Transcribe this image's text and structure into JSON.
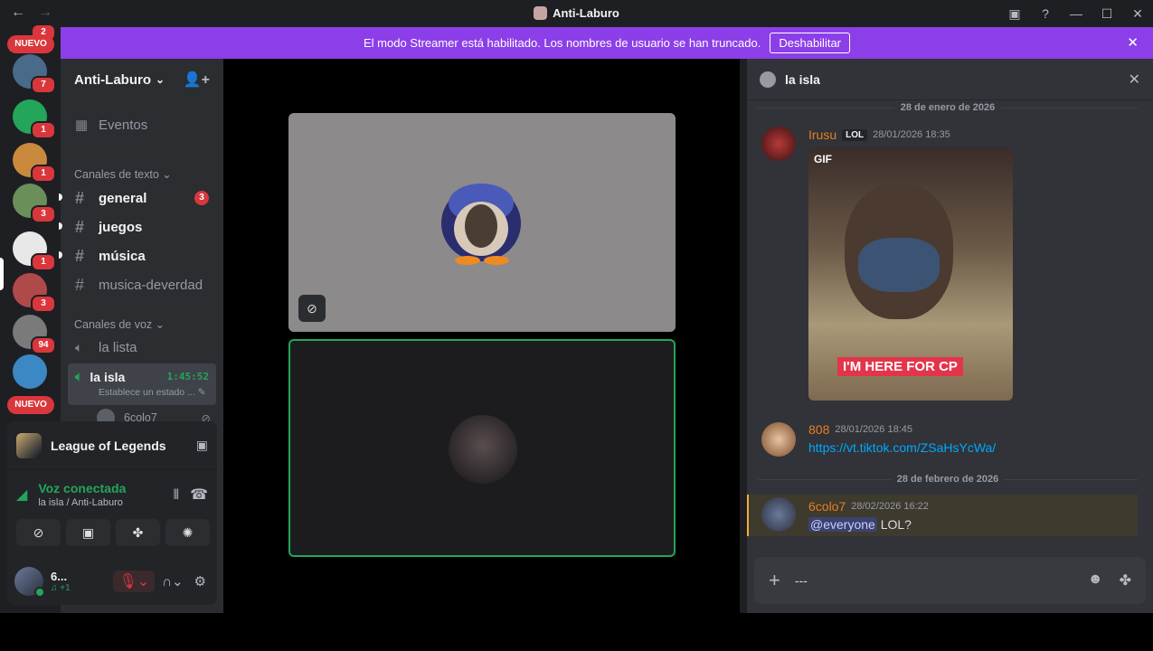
{
  "window": {
    "title": "Anti-Laburo",
    "back_icon": "←",
    "forward_icon": "→",
    "controls": [
      "▣",
      "?",
      "—",
      "☐",
      "✕"
    ]
  },
  "banner": {
    "text": "El modo Streamer está habilitado. Los nombres de usuario se han truncado.",
    "button": "Deshabilitar",
    "close": "✕"
  },
  "rail": {
    "top_badge": "2",
    "nuevo_top": "NUEVO",
    "nuevo_bottom": "NUEVO",
    "servers": [
      {
        "badge": "7",
        "color": "#4a6a8a"
      },
      {
        "badge": "1",
        "color": "#23a55a"
      },
      {
        "badge": "1",
        "color": "#c98a3e"
      },
      {
        "badge": "3",
        "color": "#6a8f5a"
      },
      {
        "badge": "1",
        "color": "#e8e8e8"
      },
      {
        "badge": "3",
        "color": "#b04a4a"
      },
      {
        "badge": "94",
        "color": "#7a7a7a"
      },
      {
        "badge": "",
        "color": "#3b88c4"
      }
    ]
  },
  "sidebar": {
    "guild_name": "Anti-Laburo",
    "chevron": "⌄",
    "invite_icon": "👤+",
    "events": "Eventos",
    "text_category": "Canales de texto",
    "voice_category": "Canales de voz",
    "text_channels": [
      {
        "name": "general",
        "badge": "3"
      },
      {
        "name": "juegos",
        "badge": ""
      },
      {
        "name": "música",
        "badge": ""
      },
      {
        "name": "musica-deverdad",
        "badge": ""
      }
    ],
    "voice_channels": [
      {
        "name": "la lista"
      }
    ],
    "active_voice": {
      "name": "la isla",
      "timer": "1:45:52",
      "status": "Establece un estado ..."
    },
    "voice_user": "6colo7"
  },
  "panel": {
    "activity": "League of Legends",
    "voice_title": "Voz conectada",
    "voice_sub": "la isla / Anti-Laburo",
    "username": "6...",
    "user_status": "♫ +1"
  },
  "chat": {
    "channel": "la isla",
    "date1": "28 de enero de 2026",
    "date2": "28 de febrero de 2026",
    "messages": [
      {
        "author": "Irusu",
        "tag": "LOL",
        "time": "28/01/2026 18:35",
        "author_color": "#e67e22",
        "gif_label": "GIF",
        "gif_caption": "I'M HERE FOR CP"
      },
      {
        "author": "808",
        "time": "28/01/2026 18:45",
        "author_color": "#e67e22",
        "text": "https://vt.tiktok.com/ZSaHsYcWa/"
      },
      {
        "author": "6colo7",
        "time": "28/02/2026 16:22",
        "author_color": "#e67e22",
        "mention": "@everyone",
        "text": "LOL?"
      }
    ],
    "composer_text": "---"
  }
}
